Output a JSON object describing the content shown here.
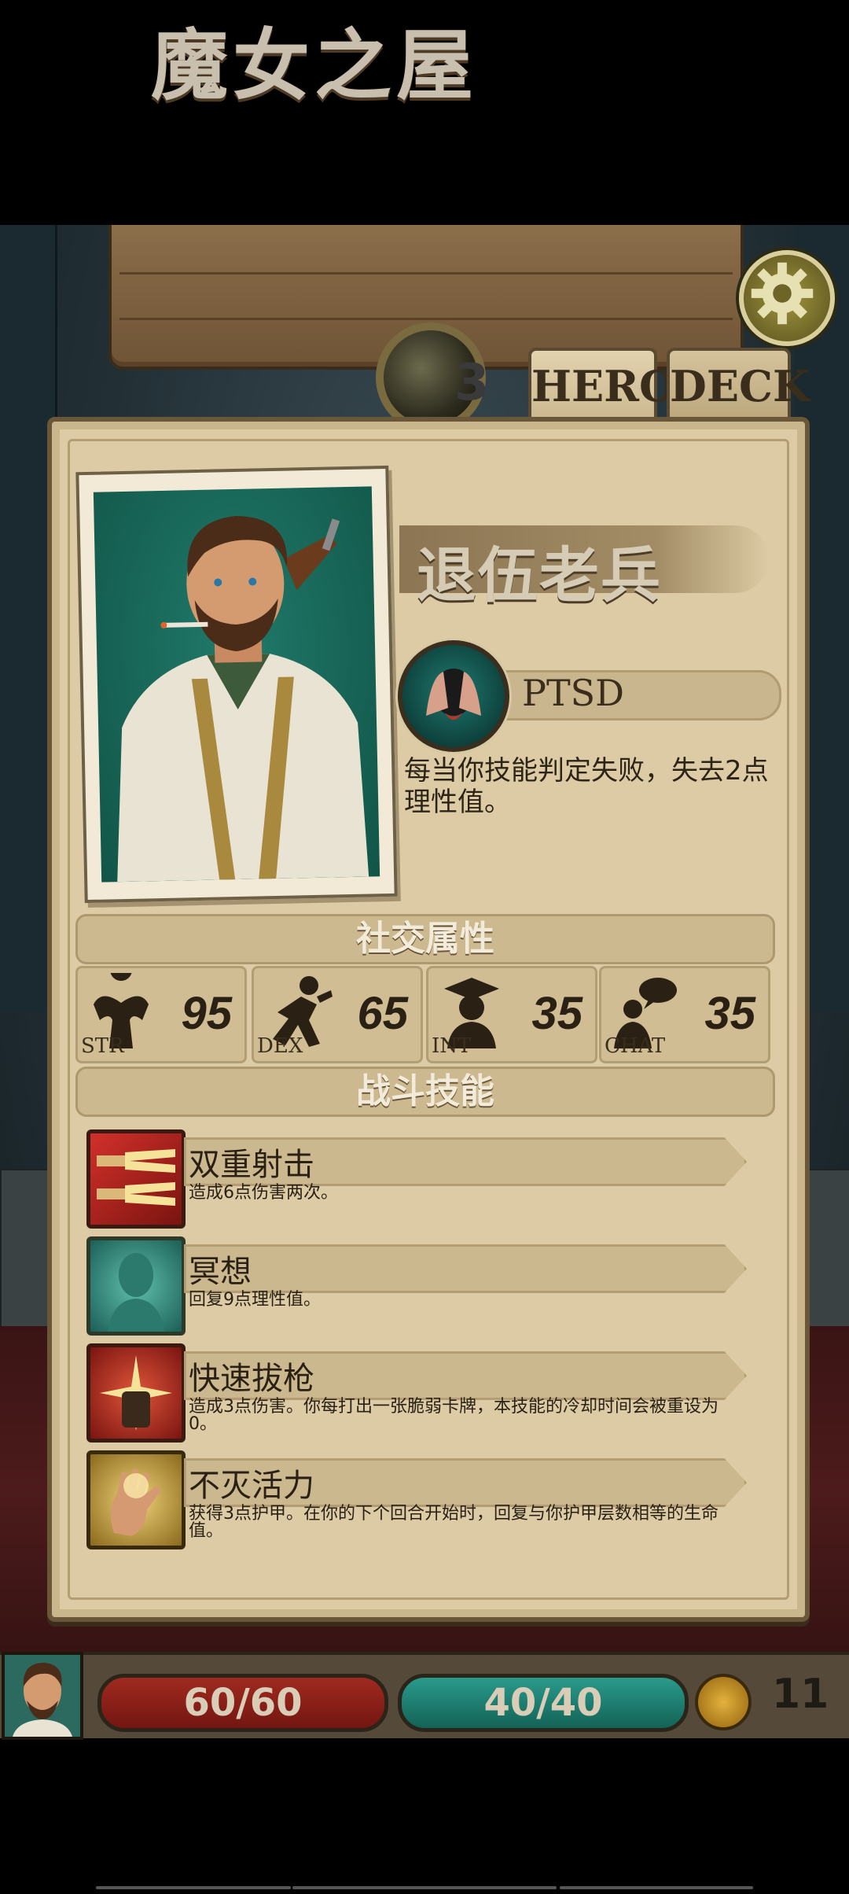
{
  "header": {
    "title": "魔女之屋",
    "level": "3",
    "tabs": [
      {
        "label": "HERO",
        "active": true
      },
      {
        "label": "DECK",
        "active": false
      }
    ],
    "settings_icon": "gear-icon"
  },
  "hero": {
    "class_name": "退伍老兵",
    "trait": {
      "name": "PTSD",
      "description": "每当你技能判定失败，失去2点理性值。",
      "icon": "head-in-hands-icon"
    }
  },
  "social": {
    "title": "社交属性",
    "stats": [
      {
        "key": "STR",
        "value": "95",
        "icon": "muscle-icon"
      },
      {
        "key": "DEX",
        "value": "65",
        "icon": "running-icon"
      },
      {
        "key": "INT",
        "value": "35",
        "icon": "scholar-icon"
      },
      {
        "key": "CHAT",
        "value": "35",
        "icon": "speech-icon"
      }
    ]
  },
  "combat": {
    "title": "战斗技能",
    "skills": [
      {
        "name": "双重射击",
        "description": "造成6点伤害两次。",
        "icon": "double-shot-icon"
      },
      {
        "name": "冥想",
        "description": "回复9点理性值。",
        "icon": "meditation-icon"
      },
      {
        "name": "快速拔枪",
        "description": "造成3点伤害。你每打出一张脆弱卡牌，本技能的冷却时间会被重设为0。",
        "icon": "quick-draw-icon"
      },
      {
        "name": "不灭活力",
        "description": "获得3点护甲。在你的下个回合开始时，回复与你护甲层数相等的生命值。",
        "icon": "vitality-icon"
      }
    ]
  },
  "status_bar": {
    "hp": "60/60",
    "sanity": "40/40",
    "coins": "11",
    "colors": {
      "hp": "#8f2219",
      "sanity": "#1f8375",
      "coin": "#d4a22e"
    }
  }
}
